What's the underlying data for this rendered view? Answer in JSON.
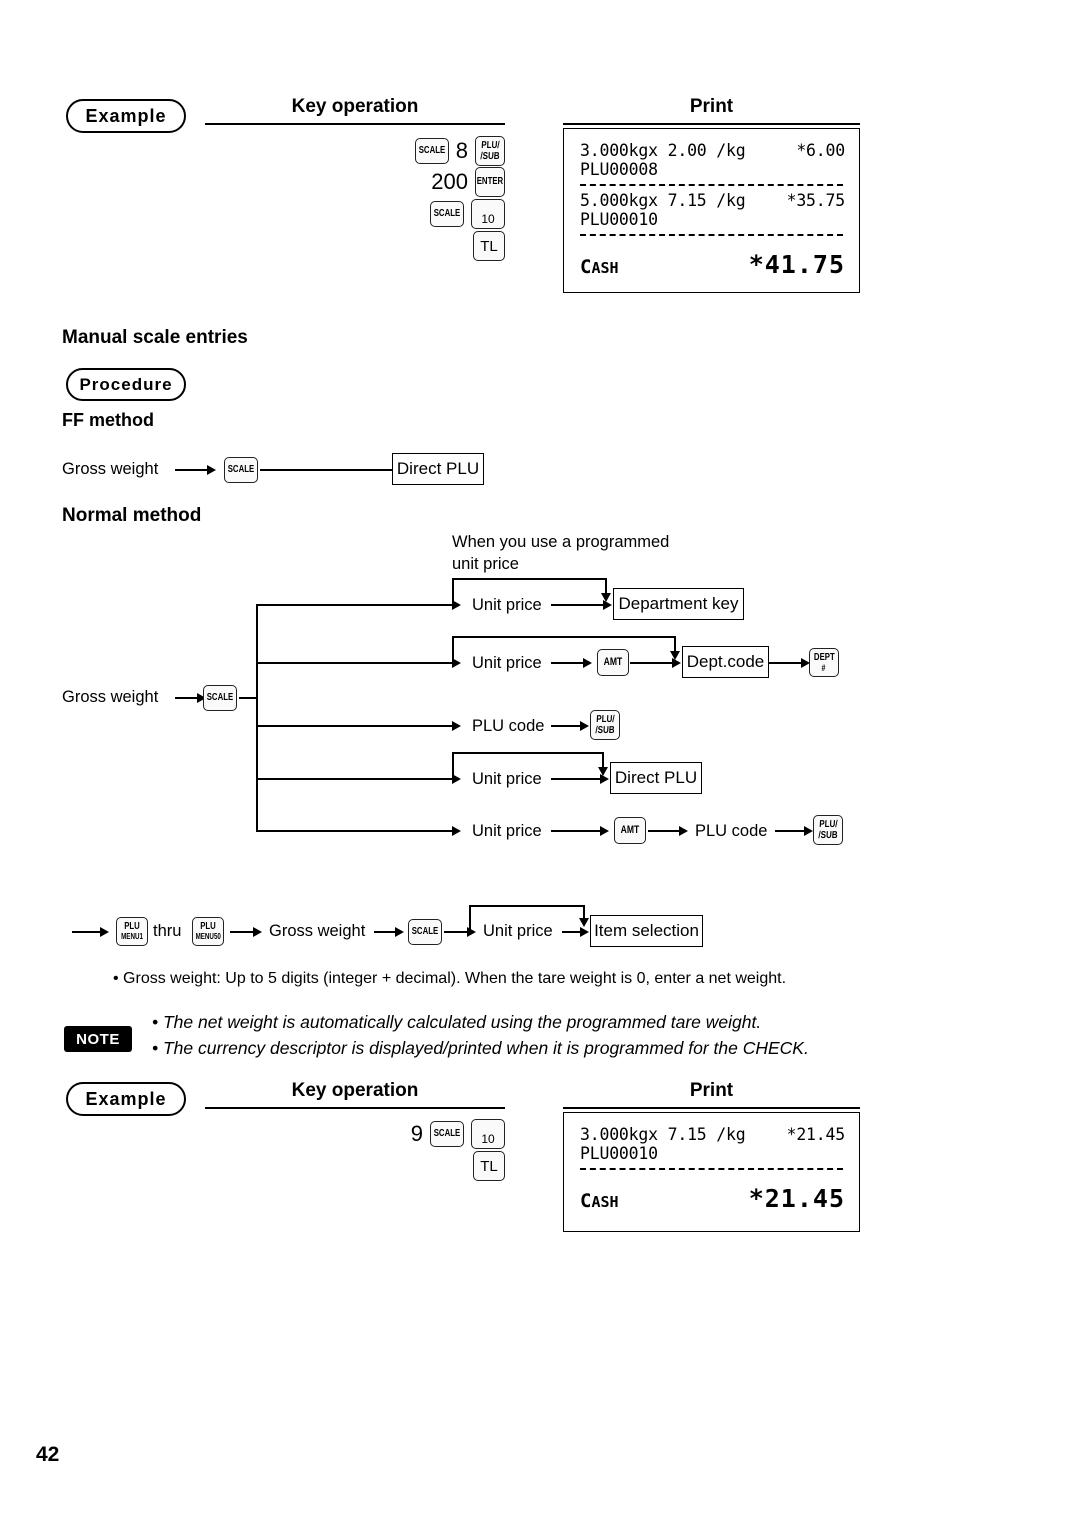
{
  "page": {
    "number": "42"
  },
  "example_top": {
    "badge": "Example",
    "key_operation_header": "Key operation",
    "print_header": "Print",
    "keys": {
      "scale": "SCALE",
      "digit8": "8",
      "plu_sub_top": "PLU/",
      "plu_sub_bottom": "/SUB",
      "num200": "200",
      "enter": "ENTER",
      "scale2": "SCALE",
      "ten": "10",
      "tl": "TL"
    },
    "receipt": {
      "line1_left": "3.000kgx 2.00 /kg",
      "line1_amount": "*6.00",
      "line1_plu": "PLU00008",
      "line2_left": "5.000kgx 7.15 /kg",
      "line2_amount": "*35.75",
      "line2_plu": "PLU00010",
      "total_label_cap": "C",
      "total_label_rest": "ASH",
      "total_amount": "*41.75"
    }
  },
  "section": {
    "title": "Manual scale entries",
    "procedure_badge": "Procedure",
    "ff_method_title": "FF method",
    "normal_method_title": "Normal method"
  },
  "ff_method": {
    "gross_weight": "Gross weight",
    "scale_key": "SCALE",
    "direct_plu": "Direct PLU"
  },
  "normal_method": {
    "gross_weight": "Gross weight",
    "scale_key": "SCALE",
    "programmed_note_line1": "When you use a programmed",
    "programmed_note_line2": "unit price",
    "branch1": {
      "unit_price": "Unit price",
      "target": "Department key"
    },
    "branch2": {
      "unit_price": "Unit price",
      "amt_key": "AMT",
      "dept_code": "Dept.code",
      "dept_key_top": "DEPT",
      "dept_key_bottom": "#"
    },
    "branch3": {
      "plu_code": "PLU code",
      "plu_key_top": "PLU/",
      "plu_key_bottom": "/SUB"
    },
    "branch4": {
      "unit_price": "Unit price",
      "target": "Direct PLU"
    },
    "branch5": {
      "unit_price": "Unit price",
      "amt_key": "AMT",
      "plu_code": "PLU code",
      "plu_key_top": "PLU/",
      "plu_key_bottom": "/SUB"
    }
  },
  "menu_row": {
    "plu_menu1_top": "PLU",
    "plu_menu1_bottom": "MENU1",
    "thru": "thru",
    "plu_menu50_top": "PLU",
    "plu_menu50_bottom": "MENU50",
    "gross_weight": "Gross weight",
    "scale_key": "SCALE",
    "unit_price": "Unit price",
    "item_selection": "Item selection"
  },
  "bullets": {
    "gross_weight_note": "• Gross weight: Up to 5 digits (integer + decimal). When the tare weight is 0, enter a net weight."
  },
  "note": {
    "badge": "NOTE",
    "line1": "• The net weight is automatically calculated using the programmed tare weight.",
    "line2": "• The currency descriptor is displayed/printed when it is programmed for the CHECK."
  },
  "example_bottom": {
    "badge": "Example",
    "key_operation_header": "Key operation",
    "print_header": "Print",
    "keys": {
      "digit9": "9",
      "scale": "SCALE",
      "ten": "10",
      "tl": "TL"
    },
    "receipt": {
      "line1_left": "3.000kgx 7.15 /kg",
      "line1_amount": "*21.45",
      "line1_plu": "PLU00010",
      "total_label_cap": "C",
      "total_label_rest": "ASH",
      "total_amount": "*21.45"
    }
  }
}
